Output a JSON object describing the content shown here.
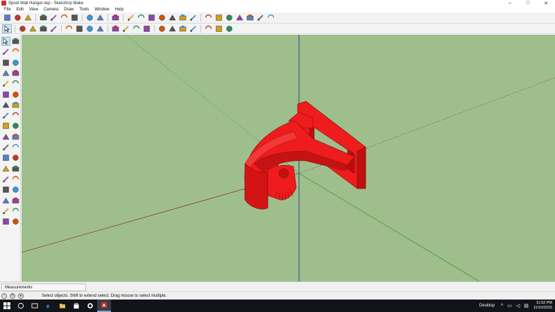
{
  "window": {
    "title": "Spool Wall Hanger.skp - SketchUp Make",
    "minimize_glyph": "–",
    "maximize_glyph": "□",
    "close_glyph": "✕"
  },
  "menu": {
    "items": [
      "File",
      "Edit",
      "View",
      "Camera",
      "Draw",
      "Tools",
      "Window",
      "Help"
    ]
  },
  "toolbar1": {
    "icons": [
      "new-icon",
      "open-icon",
      "save-icon",
      "cut-icon",
      "copy-icon",
      "paste-icon",
      "erase-icon",
      "undo-icon",
      "redo-icon",
      "print-icon",
      "model-info-icon",
      "components-icon",
      "materials-icon",
      "styles-icon",
      "layers-icon",
      "scenes-icon",
      "shadows-icon",
      "warehouse-icon",
      "share-icon",
      "extension-icon",
      "component-share-icon",
      "photo-icon",
      "texture-icon",
      "extension-warehouse-icon"
    ]
  },
  "toolbar2": {
    "icons": [
      "select-icon",
      "eraser-icon",
      "line-icon",
      "arc-icon",
      "shape-icon",
      "push-pull-icon",
      "move-icon",
      "rotate-icon",
      "scale-icon",
      "offset-icon",
      "tape-icon",
      "text-icon",
      "paint-icon",
      "orbit-icon",
      "pan-icon",
      "zoom-icon",
      "zoom-extents-icon",
      "section-icon",
      "position-camera-icon",
      "walk-icon"
    ]
  },
  "palette": {
    "icons": [
      "select-icon",
      "make-component-icon",
      "paint-bucket-icon",
      "eraser-icon",
      "line-icon",
      "freehand-icon",
      "rectangle-icon",
      "rotated-rectangle-icon",
      "circle-icon",
      "polygon-icon",
      "arc-icon",
      "pie-icon",
      "two-point-arc-icon",
      "three-point-arc-icon",
      "move-icon",
      "push-pull-icon",
      "rotate-icon",
      "follow-me-icon",
      "scale-icon",
      "offset-icon",
      "tape-measure-icon",
      "dimension-icon",
      "protractor-icon",
      "text-icon",
      "axes-icon",
      "3d-text-icon",
      "orbit-icon",
      "pan-icon",
      "zoom-icon",
      "zoom-window-icon",
      "zoom-extents-icon",
      "previous-view-icon",
      "position-camera-icon",
      "look-around-icon",
      "walk-icon",
      "section-plane-icon"
    ]
  },
  "viewport": {
    "background": "#9ebf8c",
    "model_color": "#ee1c1c",
    "model_dark": "#b00f0f",
    "axis_red": "#8c3a2a",
    "axis_green": "#3c9a3c",
    "axis_blue": "#2a3f8a"
  },
  "measurements": {
    "label": "Measurements"
  },
  "status": {
    "message": "Select objects. Shift to extend select. Drag mouse to select multiple."
  },
  "taskbar": {
    "desktop_label": "Desktop",
    "time": "11:52 PM",
    "date": "11/10/2015"
  }
}
